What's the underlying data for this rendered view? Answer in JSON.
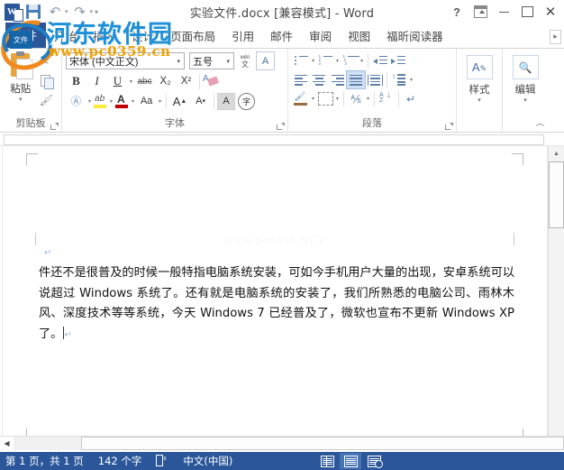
{
  "window": {
    "title": "实验文件.docx [兼容模式] - Word",
    "quick_access": [
      {
        "name": "word-logo",
        "label": "W"
      },
      {
        "name": "save-icon",
        "label": "保存"
      },
      {
        "name": "undo-icon",
        "label": "撤销"
      },
      {
        "name": "redo-icon",
        "label": "恢复"
      },
      {
        "name": "customize-qat-icon",
        "label": "自定义快速访问工具栏"
      }
    ],
    "buttons": [
      {
        "name": "help-button",
        "glyph": "?"
      },
      {
        "name": "ribbon-display-options-button",
        "glyph": "ribbon"
      },
      {
        "name": "minimize-button",
        "glyph": "—"
      },
      {
        "name": "maximize-button",
        "glyph": "▫"
      },
      {
        "name": "close-button",
        "glyph": "✕"
      }
    ]
  },
  "tabs": {
    "file_label": "文件",
    "items": [
      "开始",
      "插入",
      "设计",
      "页面布局",
      "引用",
      "邮件",
      "审阅",
      "视图",
      "福昕阅读器"
    ],
    "overflow": "▸"
  },
  "ribbon": {
    "groups": [
      {
        "name": "clipboard",
        "label": "剪贴板"
      },
      {
        "name": "font",
        "label": "字体"
      },
      {
        "name": "paragraph",
        "label": "段落"
      },
      {
        "name": "styles",
        "label": "样式"
      },
      {
        "name": "editing",
        "label": "编辑"
      }
    ],
    "clipboard": {
      "paste_label": "粘贴",
      "paste_dropdown": "▾",
      "cut_label": "剪切",
      "copy_label": "复制",
      "format_painter_label": "格式刷",
      "group_label": "剪贴板"
    },
    "font": {
      "font_name_value": "宋体 (中文正文)",
      "font_size_value": "五号",
      "phonetic_label": "拼音指南",
      "enclose_label": "字符边框",
      "bold": "B",
      "italic": "I",
      "underline": "U",
      "strikethrough": "abc",
      "subscript": "X₂",
      "superscript": "X²",
      "clear_formatting_label": "清除所有格式",
      "text_effects": "A",
      "highlight": "ab",
      "font_color": "A",
      "change_case": "Aa",
      "grow_font": "A",
      "shrink_font": "A",
      "char_shading": "A",
      "char_border": "字",
      "group_label": "字体"
    },
    "paragraph": {
      "bullets_label": "项目符号",
      "numbering_label": "编号",
      "multilevel_label": "多级列表",
      "decrease_indent_label": "减少缩进量",
      "increase_indent_label": "增加缩进量",
      "align_left_label": "左对齐",
      "align_center_label": "居中",
      "align_right_label": "右对齐",
      "justify_label": "两端对齐",
      "distribute_label": "分散对齐",
      "line_spacing_label": "行和段落间距",
      "shading_label": "底纹",
      "borders_label": "边框",
      "asian_layout_label": "中文版式",
      "sort_label": "排序",
      "show_marks_label": "显示/隐藏编辑标记",
      "group_label": "段落",
      "active_button": "justify"
    },
    "styles": {
      "label": "样式",
      "dropdown": "▾"
    },
    "editing": {
      "label": "编辑",
      "dropdown": "▾"
    },
    "collapse_label": "折叠功能区"
  },
  "document": {
    "watermark_faint": "www.pc0359.NET",
    "paragraph_mark": "↵",
    "body_text": "件还不是很普及的时候一般特指电脑系统安装，可如今手机用户大量的出现，安卓系统可以说超过 Windows 系统了。还有就是电脑系统的安装了，我们所熟悉的电脑公司、雨林木风、深度技术等等系统，今天 Windows 7 已经普及了，微软也宣布不更新 Windows XP 了。",
    "end_mark": "↵"
  },
  "scrollbars": {
    "up_arrow": "▲",
    "down_arrow": "▼",
    "left_arrow": "◀",
    "right_arrow": "▶"
  },
  "status_bar": {
    "page_info": "第 1 页，共 1 页",
    "word_count": "142 个字",
    "proofing_label": "校对",
    "language": "中文(中国)",
    "views": [
      {
        "name": "read-mode",
        "label": "阅读视图",
        "active": false
      },
      {
        "name": "print-layout",
        "label": "页面视图",
        "active": true
      },
      {
        "name": "web-layout",
        "label": "Web 版式视图",
        "active": false
      }
    ]
  },
  "overlay_watermark": {
    "badge_text": "文件",
    "site_name": "河东软件园",
    "site_url": "www.pc0359.cn",
    "colors": {
      "blue": "#1f8fd6",
      "orange": "#f0a000",
      "accent": "#2b579a"
    }
  }
}
